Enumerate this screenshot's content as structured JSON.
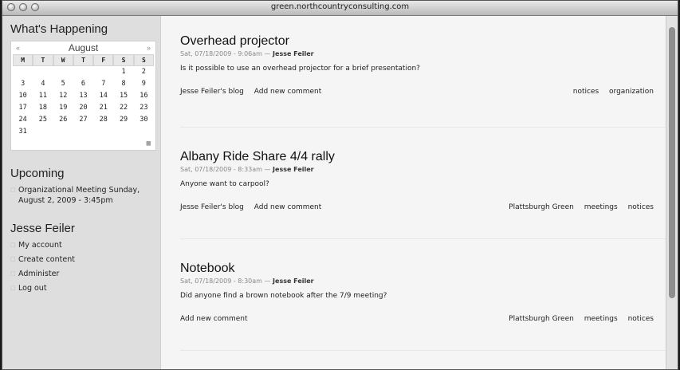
{
  "window": {
    "title": "green.northcountryconsulting.com"
  },
  "sidebar": {
    "whats_happening": "What's Happening",
    "calendar": {
      "prev": "«",
      "next": "»",
      "month": "August",
      "dow": [
        "M",
        "T",
        "W",
        "T",
        "F",
        "S",
        "S"
      ],
      "weeks": [
        [
          "",
          "",
          "",
          "",
          "",
          "1",
          "2"
        ],
        [
          "3",
          "4",
          "5",
          "6",
          "7",
          "8",
          "9"
        ],
        [
          "10",
          "11",
          "12",
          "13",
          "14",
          "15",
          "16"
        ],
        [
          "17",
          "18",
          "19",
          "20",
          "21",
          "22",
          "23"
        ],
        [
          "24",
          "25",
          "26",
          "27",
          "28",
          "29",
          "30"
        ],
        [
          "31",
          "",
          "",
          "",
          "",
          "",
          ""
        ]
      ]
    },
    "upcoming": {
      "heading": "Upcoming",
      "item": "Organizational Meeting Sunday, August 2, 2009 - 3:45pm"
    },
    "user": {
      "heading": "Jesse Feiler",
      "items": [
        "My account",
        "Create content",
        "Administer",
        "Log out"
      ]
    }
  },
  "main": {
    "nodes": [
      {
        "title": "Overhead projector",
        "date": "Sat, 07/18/2009 - 9:06am",
        "author": "Jesse Feiler",
        "body": "Is it possible to use an overhead projector for a brief presentation?",
        "left_links": [
          "Jesse Feiler's blog",
          "Add new comment"
        ],
        "tags": [
          "notices",
          "organization"
        ]
      },
      {
        "title": "Albany Ride Share 4/4 rally",
        "date": "Sat, 07/18/2009 - 8:33am",
        "author": "Jesse Feiler",
        "body": "Anyone want to carpool?",
        "left_links": [
          "Jesse Feiler's blog",
          "Add new comment"
        ],
        "tags": [
          "Plattsburgh Green",
          "meetings",
          "notices"
        ]
      },
      {
        "title": "Notebook",
        "date": "Sat, 07/18/2009 - 8:30am",
        "author": "Jesse Feiler",
        "body": "Did anyone find a brown notebook after the 7/9 meeting?",
        "left_links": [
          "Add new comment"
        ],
        "tags": [
          "Plattsburgh Green",
          "meetings",
          "notices"
        ]
      }
    ]
  }
}
